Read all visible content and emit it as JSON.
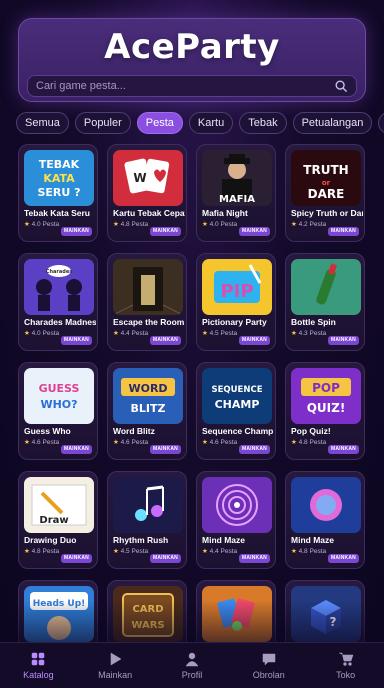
{
  "header": {
    "title": "AceParty",
    "search_placeholder": "Cari game pesta..."
  },
  "categories": [
    "Semua",
    "Populer",
    "Pesta",
    "Kartu",
    "Tebak",
    "Petualangan",
    "Klasik"
  ],
  "active_category": "Pesta",
  "games": [
    {
      "name": "Tebak Kata Seru",
      "rating": "4.0",
      "tag": "Pesta",
      "badge": "MAINKAN",
      "thumb_text": "TEBAK KATA SERU?",
      "bg": "#2a8fd8"
    },
    {
      "name": "Kartu Tebak Cepat",
      "rating": "4.8",
      "tag": "Pesta",
      "badge": "MAINKAN",
      "thumb_text": "W",
      "bg": "#d12d3c"
    },
    {
      "name": "Mafia Night",
      "rating": "4.0",
      "tag": "Pesta",
      "badge": "MAINKAN",
      "thumb_text": "MAFIA",
      "bg": "#2a1f33"
    },
    {
      "name": "Spicy Truth or Dare",
      "rating": "4.2",
      "tag": "Pesta",
      "badge": "MAINKAN",
      "thumb_text": "TRUTH or DARE",
      "bg": "#2a0a0f"
    },
    {
      "name": "Charades Madness",
      "rating": "4.0",
      "tag": "Pesta",
      "badge": "MAINKAN",
      "thumb_text": "Charades",
      "bg": "#5b3fc4"
    },
    {
      "name": "Escape the Room",
      "rating": "4.4",
      "tag": "Pesta",
      "badge": "MAINKAN",
      "thumb_text": "",
      "bg": "#3c2f22"
    },
    {
      "name": "Pictionary Party",
      "rating": "4.5",
      "tag": "Pesta",
      "badge": "MAINKAN",
      "thumb_text": "PIP",
      "bg": "#f5c52e"
    },
    {
      "name": "Bottle Spin",
      "rating": "4.3",
      "tag": "Pesta",
      "badge": "MAINKAN",
      "thumb_text": "",
      "bg": "#3a9a7e"
    },
    {
      "name": "Guess Who",
      "rating": "4.6",
      "tag": "Pesta",
      "badge": "MAINKAN",
      "thumb_text": "GUESS WHO?",
      "bg": "#e9f1fb"
    },
    {
      "name": "Word Blitz",
      "rating": "4.6",
      "tag": "Pesta",
      "badge": "MAINKAN",
      "thumb_text": "WORD BLITZ",
      "bg": "#2a5fb8"
    },
    {
      "name": "Sequence Champ",
      "rating": "4.6",
      "tag": "Pesta",
      "badge": "MAINKAN",
      "thumb_text": "SEQUENCE CHAMP",
      "bg": "#0d3c78"
    },
    {
      "name": "Pop Quiz!",
      "rating": "4.8",
      "tag": "Pesta",
      "badge": "MAINKAN",
      "thumb_text": "POP QUIZ!",
      "bg": "#7e2fc9"
    },
    {
      "name": "Drawing Duo",
      "rating": "4.8",
      "tag": "Pesta",
      "badge": "MAINKAN",
      "thumb_text": "Draw",
      "bg": "#f4efe2"
    },
    {
      "name": "Rhythm Rush",
      "rating": "4.5",
      "tag": "Pesta",
      "badge": "MAINKAN",
      "thumb_text": "",
      "bg": "#1c1a48"
    },
    {
      "name": "Mind Maze",
      "rating": "4.4",
      "tag": "Pesta",
      "badge": "MAINKAN",
      "thumb_text": "",
      "bg": "#6c2fb8"
    },
    {
      "name": "Mind Maze",
      "rating": "4.8",
      "tag": "Pesta",
      "badge": "MAINKAN",
      "thumb_text": "",
      "bg": "#1f3d9a"
    },
    {
      "name": "Heads Up!",
      "rating": "",
      "tag": "",
      "badge": "",
      "thumb_text": "Heads Up!",
      "bg": "#2f7fd8"
    },
    {
      "name": "Card Wars",
      "rating": "",
      "tag": "",
      "badge": "",
      "thumb_text": "CARD WARS",
      "bg": "#4a2a1a"
    },
    {
      "name": "Card Wars",
      "rating": "",
      "tag": "",
      "badge": "",
      "thumb_text": "",
      "bg": "#d87a2a"
    },
    {
      "name": "Mystery Box",
      "rating": "",
      "tag": "",
      "badge": "",
      "thumb_text": "?",
      "bg": "#233a80"
    }
  ],
  "nav": {
    "items": [
      {
        "label": "Katalog",
        "icon": "grid-icon"
      },
      {
        "label": "Mainkan",
        "icon": "play-icon"
      },
      {
        "label": "Profil",
        "icon": "user-icon"
      },
      {
        "label": "Obrolan",
        "icon": "chat-icon"
      },
      {
        "label": "Toko",
        "icon": "cart-icon"
      }
    ],
    "active": "Katalog"
  },
  "colors": {
    "accent": "#8a4fe0",
    "background": "#140a2a",
    "star": "#f6c443"
  }
}
